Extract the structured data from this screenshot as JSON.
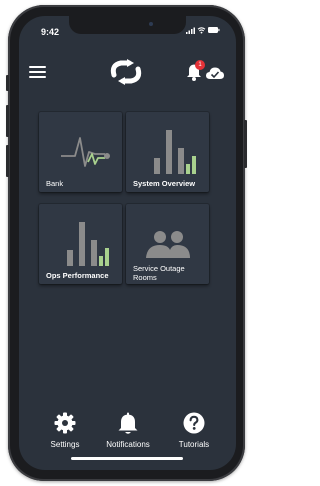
{
  "status_bar": {
    "time": "9:42"
  },
  "header": {
    "notification_count": "1"
  },
  "tiles": [
    {
      "label": "Bank",
      "icon": "pulse-chart-icon"
    },
    {
      "label": "System Overview",
      "icon": "bar-chart-icon"
    },
    {
      "label": "Ops Performance",
      "icon": "bar-chart-icon"
    },
    {
      "label": "Service Outage Rooms",
      "icon": "people-group-icon"
    }
  ],
  "bottom_nav": [
    {
      "label": "Settings",
      "icon": "gear-icon"
    },
    {
      "label": "Notifications",
      "icon": "bell-icon"
    },
    {
      "label": "Tutorials",
      "icon": "help-icon"
    }
  ],
  "colors": {
    "background": "#2b323c",
    "tile": "#303844",
    "chart_gray": "#8b8b8b",
    "chart_green": "#a9d18e",
    "badge": "#e53238"
  }
}
